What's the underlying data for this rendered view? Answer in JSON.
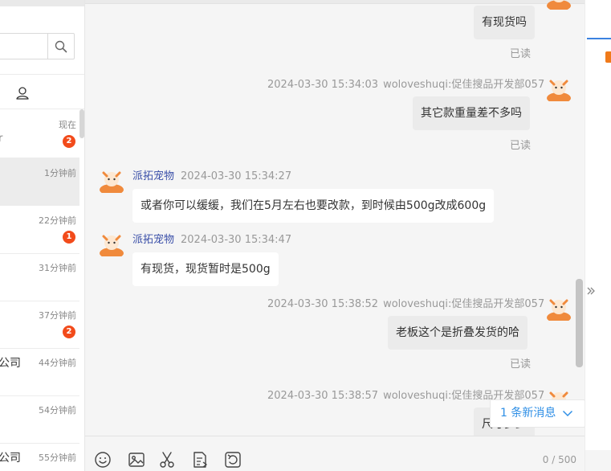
{
  "sidebar": {
    "search": {
      "placeholder": ""
    },
    "conversations": [
      {
        "name": "",
        "trail": "r",
        "time": "现在",
        "badge": "2",
        "selected": false
      },
      {
        "name": "",
        "trail": "",
        "time": "1分钟前",
        "badge": "",
        "selected": true
      },
      {
        "name": "",
        "trail": "",
        "time": "22分钟前",
        "badge": "1",
        "selected": false
      },
      {
        "name": "",
        "trail": "",
        "time": "31分钟前",
        "badge": "",
        "selected": false
      },
      {
        "name": "",
        "trail": "",
        "time": "37分钟前",
        "badge": "2",
        "selected": false
      },
      {
        "name": "公司",
        "trail": "",
        "time": "44分钟前",
        "badge": "",
        "selected": false
      },
      {
        "name": "",
        "trail": "",
        "time": "54分钟前",
        "badge": "",
        "selected": false
      },
      {
        "name": "公司",
        "trail": "",
        "time": "55分钟前",
        "badge": "",
        "selected": false
      }
    ]
  },
  "chat": {
    "messages": [
      {
        "text": "有现货吗",
        "read": "已读"
      },
      {
        "timestamp": "2024-03-30 15:34:03",
        "sender": "woloveshuqi:促佳搜品开发部057",
        "text": "其它款重量差不多吗",
        "read": "已读"
      },
      {
        "timestamp": "2024-03-30 15:34:27",
        "sender": "派拓宠物",
        "text": "或者你可以缓缓，我们在5月左右也要改款，到时候由500g改成600g"
      },
      {
        "timestamp": "2024-03-30 15:34:47",
        "sender": "派拓宠物",
        "text": "有现货，现货暂时是500g"
      },
      {
        "timestamp": "2024-03-30 15:38:52",
        "sender": "woloveshuqi:促佳搜品开发部057",
        "text": "老板这个是折叠发货的哈",
        "read": "已读"
      },
      {
        "timestamp": "2024-03-30 15:38:57",
        "sender": "woloveshuqi:促佳搜品开发部057",
        "text": "尺寸多少"
      }
    ],
    "new_message_label": "1 条新消息"
  },
  "toolbar": {
    "tools": [
      "emoji-icon",
      "image-icon",
      "scissors-icon",
      "document-icon",
      "rotate-icon"
    ],
    "counter": "0 / 500"
  },
  "colors": {
    "badge": "#f24b1b",
    "sender_name": "#3a4fa8",
    "new_message": "#2f8fe6",
    "accent_line": "#3b82e0",
    "avatar_orange": "#f08a3c"
  }
}
